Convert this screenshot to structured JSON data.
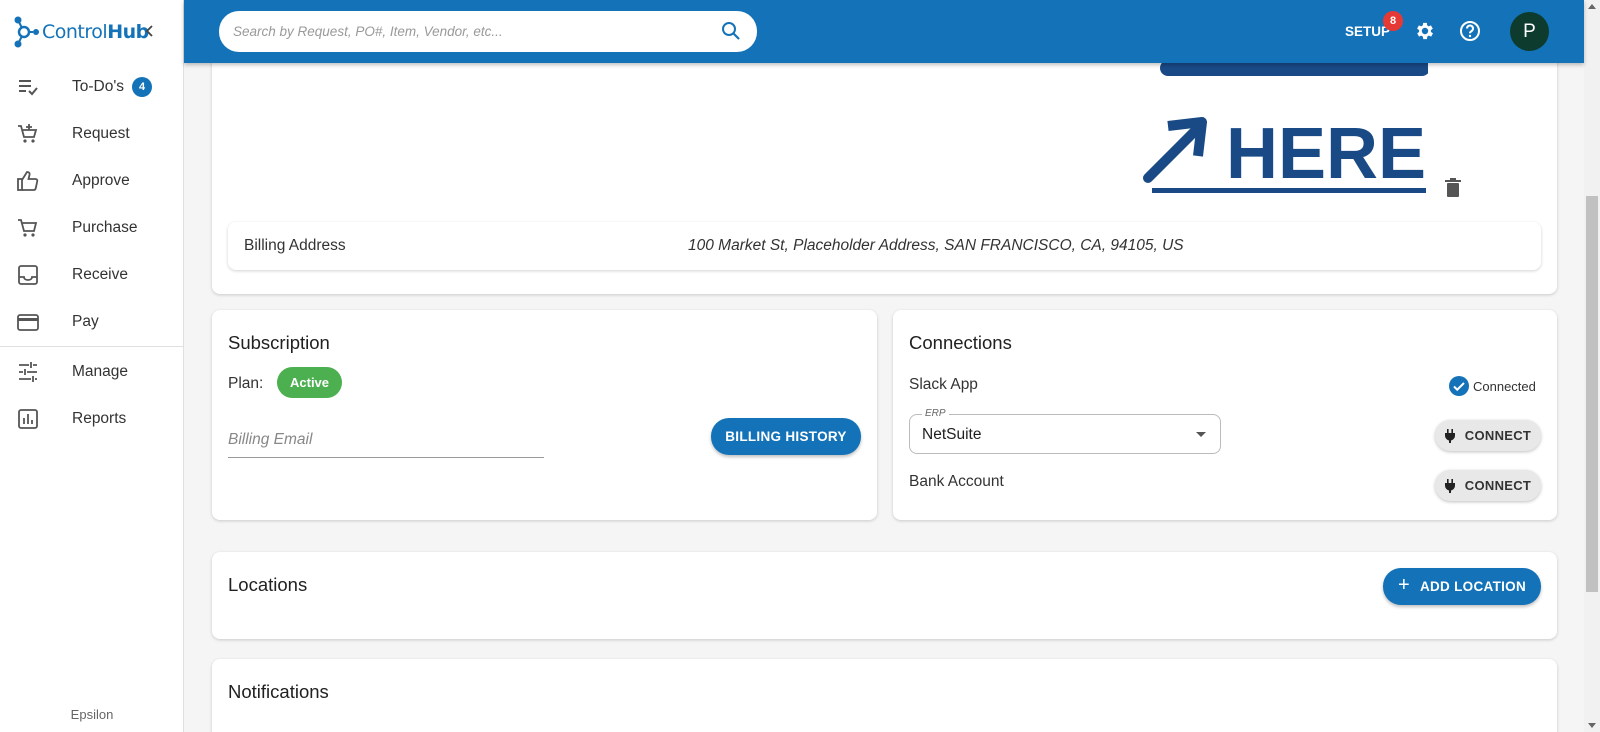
{
  "app": {
    "brand": {
      "prefix": "Control",
      "suffix": "Hub"
    },
    "tenant": "Epsilon"
  },
  "sidebar": {
    "items": [
      {
        "label": "To-Do's",
        "icon": "checklist-icon",
        "badge": "4"
      },
      {
        "label": "Request",
        "icon": "cart-add-icon"
      },
      {
        "label": "Approve",
        "icon": "thumbs-up-icon"
      },
      {
        "label": "Purchase",
        "icon": "cart-icon"
      },
      {
        "label": "Receive",
        "icon": "inbox-icon"
      },
      {
        "label": "Pay",
        "icon": "credit-card-icon"
      },
      {
        "label": "Manage",
        "icon": "sliders-icon"
      },
      {
        "label": "Reports",
        "icon": "bar-chart-icon"
      }
    ]
  },
  "topbar": {
    "search_placeholder": "Search by Request, PO#, Item, Vendor, etc...",
    "setup_label": "SETUP",
    "setup_badge": "8",
    "avatar_initial": "P"
  },
  "company": {
    "logo_text": "HERE",
    "billing_address_label": "Billing Address",
    "billing_address_value": "100 Market St, Placeholder Address, SAN FRANCISCO, CA, 94105, US"
  },
  "subscription": {
    "title": "Subscription",
    "plan_label": "Plan:",
    "plan_status": "Active",
    "billing_email_placeholder": "Billing Email",
    "billing_history_label": "BILLING HISTORY"
  },
  "connections": {
    "title": "Connections",
    "slack_label": "Slack App",
    "slack_status": "Connected",
    "erp_legend": "ERP",
    "erp_value": "NetSuite",
    "erp_connect_label": "CONNECT",
    "bank_label": "Bank Account",
    "bank_connect_label": "CONNECT"
  },
  "locations": {
    "title": "Locations",
    "add_label": "ADD LOCATION"
  },
  "notifications": {
    "title": "Notifications"
  },
  "colors": {
    "brand_blue": "#1473b8",
    "success_green": "#4caf50",
    "badge_red": "#e53935",
    "logo_navy": "#1a4a86"
  }
}
